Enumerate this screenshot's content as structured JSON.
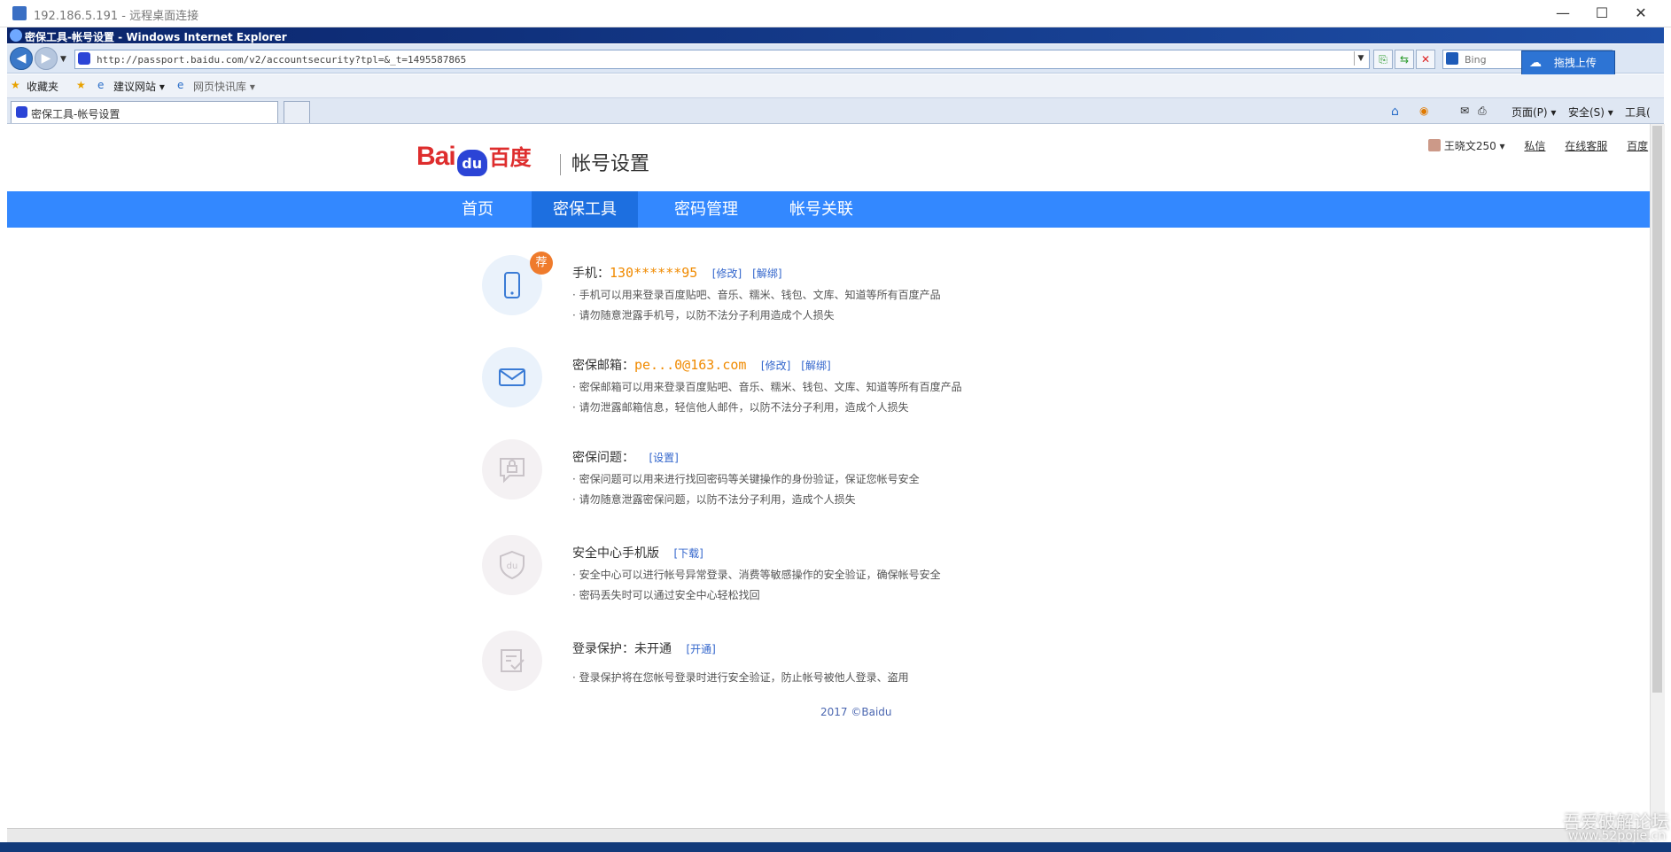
{
  "remote_desktop": {
    "title": "192.186.5.191 - 远程桌面连接"
  },
  "ie": {
    "window_title": "密保工具-帐号设置 - Windows Internet Explorer",
    "address": "http://passport.baidu.com/v2/accountsecurity?tpl=&_t=1495587865",
    "search_placeholder": "Bing",
    "upload_button": "拖拽上传",
    "favorites_label": "收藏夹",
    "favorites_items": [
      "建议网站 ▾",
      "网页快讯库 ▾"
    ],
    "tab_title": "密保工具-帐号设置",
    "command_items": [
      "页面(P) ▾",
      "安全(S) ▾",
      "工具("
    ]
  },
  "header": {
    "logo_bai": "Bai",
    "logo_du": "du",
    "logo_cn": "百度",
    "site_title": "帐号设置",
    "username": "王晓文250 ▾",
    "links": [
      "私信",
      "在线客服",
      "百度"
    ]
  },
  "nav": {
    "items": [
      {
        "label": "首页"
      },
      {
        "label": "密保工具"
      },
      {
        "label": "密码管理"
      },
      {
        "label": "帐号关联"
      }
    ]
  },
  "security_items": [
    {
      "badge": "荐",
      "label": "手机：",
      "value": "130******95",
      "links": [
        "[修改]",
        "[解绑]"
      ],
      "desc": [
        "· 手机可以用来登录百度贴吧、音乐、糯米、钱包、文库、知道等所有百度产品",
        "· 请勿随意泄露手机号，以防不法分子利用造成个人损失"
      ]
    },
    {
      "label": "密保邮箱：",
      "value": "pe...0@163.com",
      "links": [
        "[修改]",
        "[解绑]"
      ],
      "desc": [
        "· 密保邮箱可以用来登录百度贴吧、音乐、糯米、钱包、文库、知道等所有百度产品",
        "· 请勿泄露邮箱信息，轻信他人邮件，以防不法分子利用，造成个人损失"
      ]
    },
    {
      "label": "密保问题：",
      "links": [
        "[设置]"
      ],
      "desc": [
        "· 密保问题可以用来进行找回密码等关键操作的身份验证，保证您帐号安全",
        "· 请勿随意泄露密保问题，以防不法分子利用，造成个人损失"
      ]
    },
    {
      "label": "安全中心手机版",
      "links": [
        "[下载]"
      ],
      "desc": [
        "· 安全中心可以进行帐号异常登录、消费等敏感操作的安全验证，确保帐号安全",
        "· 密码丢失时可以通过安全中心轻松找回"
      ]
    },
    {
      "label": "登录保护：未开通",
      "links": [
        "[开通]"
      ],
      "desc": [
        "· 登录保护将在您帐号登录时进行安全验证，防止帐号被他人登录、盗用"
      ]
    }
  ],
  "footer": "2017 ©Baidu",
  "watermark": [
    "吾爱破解论坛",
    "www.52pojie.cn"
  ],
  "colors": {
    "nav_bg": "#3388ff",
    "nav_active": "#1d6fe0",
    "accent_value": "#f08a00",
    "link": "#3366cc",
    "badge": "#ef7b2c"
  }
}
